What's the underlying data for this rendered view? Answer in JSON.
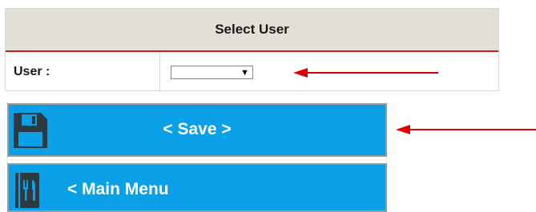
{
  "panel": {
    "title": "Select User",
    "user_label": "User :",
    "user_select_value": ""
  },
  "buttons": {
    "save_label": "< Save >",
    "main_menu_label": "< Main Menu"
  },
  "colors": {
    "button_blue": "#0aa0e8",
    "header_bg": "#e2dfd6",
    "accent_red": "#c81e1e"
  },
  "icons": {
    "save": "floppy-disk-icon",
    "main_menu": "restaurant-menu-icon",
    "dropdown": "dropdown-arrow-icon",
    "annotation": "red-arrow-icon"
  }
}
